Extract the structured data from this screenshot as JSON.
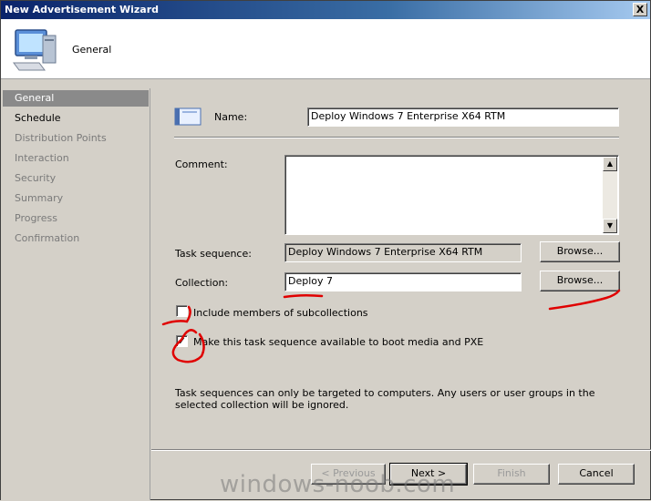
{
  "window": {
    "title": "New Advertisement Wizard",
    "close_label": "X"
  },
  "header": {
    "title": "General",
    "icon": "computer-icon"
  },
  "nav": {
    "items": [
      {
        "label": "General",
        "state": "active"
      },
      {
        "label": "Schedule",
        "state": "enabled"
      },
      {
        "label": "Distribution Points",
        "state": "disabled"
      },
      {
        "label": "Interaction",
        "state": "disabled"
      },
      {
        "label": "Security",
        "state": "disabled"
      },
      {
        "label": "Summary",
        "state": "disabled"
      },
      {
        "label": "Progress",
        "state": "disabled"
      },
      {
        "label": "Confirmation",
        "state": "disabled"
      }
    ]
  },
  "form": {
    "name_label": "Name:",
    "name_value": "Deploy Windows 7 Enterprise X64 RTM",
    "comment_label": "Comment:",
    "comment_value": "",
    "task_sequence_label": "Task sequence:",
    "task_sequence_value": "Deploy Windows 7 Enterprise X64 RTM",
    "collection_label": "Collection:",
    "collection_value": "Deploy 7",
    "browse_label": "Browse...",
    "include_subcollections_label": "Include members of subcollections",
    "include_subcollections_checked": false,
    "boot_media_label": "Make this task sequence available to boot media and PXE",
    "boot_media_checked": true,
    "note": "Task sequences can only be targeted to computers.  Any users or user groups in the selected collection will be ignored."
  },
  "buttons": {
    "previous": "< Previous",
    "next": "Next >",
    "finish": "Finish",
    "cancel": "Cancel"
  },
  "watermark": "windows-noob.com",
  "colors": {
    "annotation": "#e00000",
    "title_bar": "#0a246a"
  }
}
